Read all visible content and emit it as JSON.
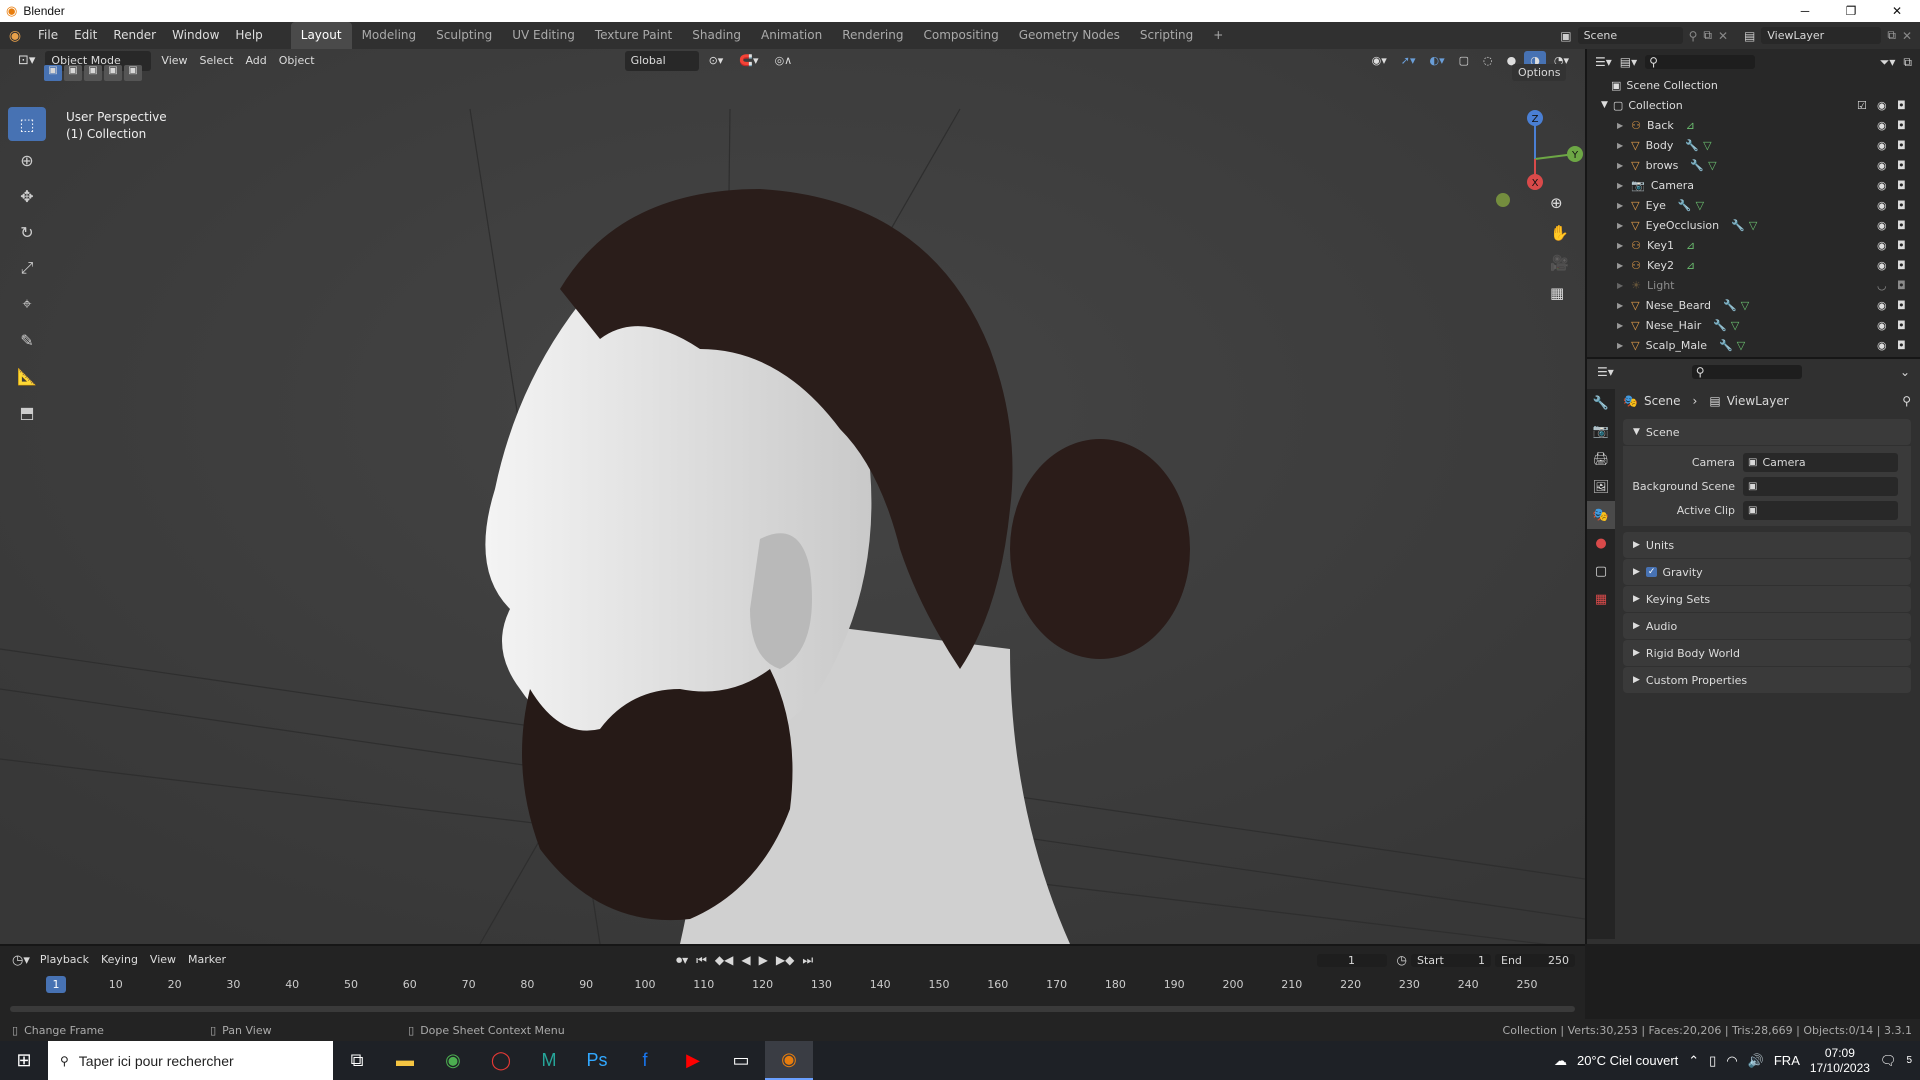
{
  "window": {
    "title": "Blender",
    "minimize": "─",
    "maximize": "❐",
    "close": "✕"
  },
  "menubar": {
    "menus": [
      "File",
      "Edit",
      "Render",
      "Window",
      "Help"
    ],
    "workspaces": [
      "Layout",
      "Modeling",
      "Sculpting",
      "UV Editing",
      "Texture Paint",
      "Shading",
      "Animation",
      "Rendering",
      "Compositing",
      "Geometry Nodes",
      "Scripting"
    ],
    "add_tab": "+",
    "scene_label": "Scene",
    "viewlayer_label": "ViewLayer"
  },
  "viewport": {
    "mode": "Object Mode",
    "menus": [
      "View",
      "Select",
      "Add",
      "Object"
    ],
    "orientation": "Global",
    "options": "Options",
    "overlay_line1": "User Perspective",
    "overlay_line2": "(1) Collection",
    "gizmo": {
      "z": "Z",
      "y": "Y",
      "x": "X"
    }
  },
  "outliner": {
    "root": "Scene Collection",
    "collection": "Collection",
    "items": [
      {
        "name": "Back",
        "type": "empty"
      },
      {
        "name": "Body",
        "type": "mesh"
      },
      {
        "name": "brows",
        "type": "mesh"
      },
      {
        "name": "Camera",
        "type": "camera"
      },
      {
        "name": "Eye",
        "type": "mesh"
      },
      {
        "name": "EyeOcclusion",
        "type": "mesh"
      },
      {
        "name": "Key1",
        "type": "empty"
      },
      {
        "name": "Key2",
        "type": "empty"
      },
      {
        "name": "Light",
        "type": "light"
      },
      {
        "name": "Nese_Beard",
        "type": "mesh"
      },
      {
        "name": "Nese_Hair",
        "type": "mesh"
      },
      {
        "name": "Scalp_Male",
        "type": "mesh"
      }
    ]
  },
  "properties": {
    "breadcrumb_scene": "Scene",
    "breadcrumb_viewlayer": "ViewLayer",
    "panel_title": "Scene",
    "fields": [
      {
        "label": "Camera",
        "value": "Camera"
      },
      {
        "label": "Background Scene",
        "value": ""
      },
      {
        "label": "Active Clip",
        "value": ""
      }
    ],
    "subpanels": [
      "Units",
      "Gravity",
      "Keying Sets",
      "Audio",
      "Rigid Body World",
      "Custom Properties"
    ]
  },
  "timeline": {
    "menus": [
      "Playback",
      "Keying",
      "View",
      "Marker"
    ],
    "current_frame": "1",
    "start_label": "Start",
    "start": "1",
    "end_label": "End",
    "end": "250",
    "ticks": [
      "10",
      "20",
      "30",
      "40",
      "50",
      "60",
      "70",
      "80",
      "90",
      "100",
      "110",
      "120",
      "130",
      "140",
      "150",
      "160",
      "170",
      "180",
      "190",
      "200",
      "210",
      "220",
      "230",
      "240",
      "250"
    ],
    "playhead": "1"
  },
  "statusbar": {
    "left1": "Change Frame",
    "left2": "Pan View",
    "left3": "Dope Sheet Context Menu",
    "right": "Collection | Verts:30,253 | Faces:20,206 | Tris:28,669 | Objects:0/14 | 3.3.1"
  },
  "taskbar": {
    "search_placeholder": "Taper ici pour rechercher",
    "weather": "20°C  Ciel couvert",
    "lang": "FRA",
    "time": "07:09",
    "date": "17/10/2023",
    "notif": "5"
  },
  "colors": {
    "accent": "#4772b3",
    "orange": "#e8a04a",
    "green": "#6bc070"
  }
}
